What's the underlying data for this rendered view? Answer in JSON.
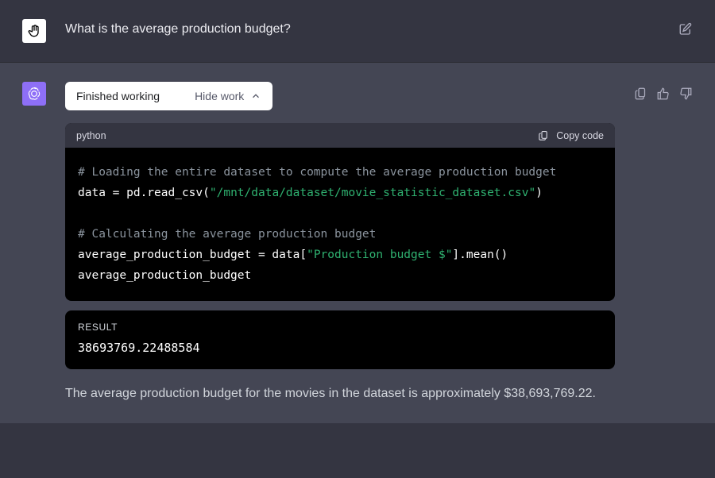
{
  "user": {
    "question": "What is the average production budget?"
  },
  "assistant": {
    "toggle": {
      "status": "Finished working",
      "action": "Hide work"
    },
    "code": {
      "language": "python",
      "copy_label": "Copy code",
      "line1_comment": "# Loading the entire dataset to compute the average production budget",
      "line2_prefix": "data = pd.read_csv(",
      "line2_string": "\"/mnt/data/dataset/movie_statistic_dataset.csv\"",
      "line2_suffix": ")",
      "line3_blank": "",
      "line4_comment": "# Calculating the average production budget",
      "line5_prefix": "average_production_budget = data[",
      "line5_string": "\"Production budget $\"",
      "line5_suffix": "].mean()",
      "line6": "average_production_budget"
    },
    "result": {
      "label": "RESULT",
      "value": "38693769.22488584"
    },
    "answer": "The average production budget for the movies in the dataset is approximately $38,693,769.22."
  }
}
